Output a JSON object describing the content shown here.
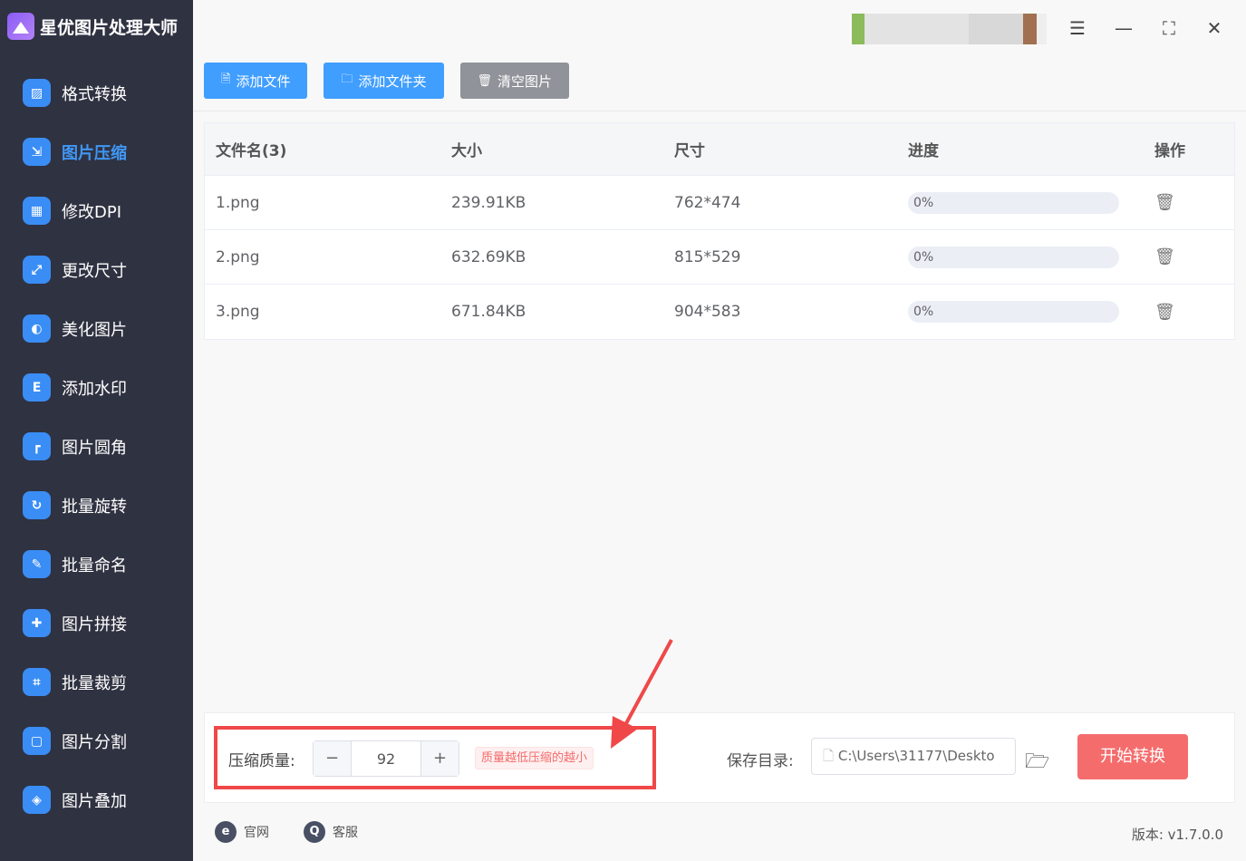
{
  "app": {
    "title": "星优图片处理大师",
    "accent": "#409eff"
  },
  "sidebar": {
    "items": [
      {
        "label": "格式转换",
        "icon": "image-convert-icon",
        "active": false
      },
      {
        "label": "图片压缩",
        "icon": "image-compress-icon",
        "active": true
      },
      {
        "label": "修改DPI",
        "icon": "dpi-icon",
        "active": false
      },
      {
        "label": "更改尺寸",
        "icon": "resize-icon",
        "active": false
      },
      {
        "label": "美化图片",
        "icon": "beautify-icon",
        "active": false
      },
      {
        "label": "添加水印",
        "icon": "watermark-icon",
        "active": false
      },
      {
        "label": "图片圆角",
        "icon": "round-corner-icon",
        "active": false
      },
      {
        "label": "批量旋转",
        "icon": "rotate-icon",
        "active": false
      },
      {
        "label": "批量命名",
        "icon": "rename-icon",
        "active": false
      },
      {
        "label": "图片拼接",
        "icon": "puzzle-icon",
        "active": false
      },
      {
        "label": "批量裁剪",
        "icon": "crop-icon",
        "active": false
      },
      {
        "label": "图片分割",
        "icon": "split-icon",
        "active": false
      },
      {
        "label": "图片叠加",
        "icon": "layers-icon",
        "active": false
      }
    ]
  },
  "toolbar": {
    "add_file": "添加文件",
    "add_folder": "添加文件夹",
    "clear": "清空图片"
  },
  "table": {
    "headers": [
      "文件名(3)",
      "大小",
      "尺寸",
      "进度",
      "操作"
    ],
    "rows": [
      {
        "name": "1.png",
        "size": "239.91KB",
        "dims": "762*474",
        "progress": "0%",
        "progress_value": 0
      },
      {
        "name": "2.png",
        "size": "632.69KB",
        "dims": "815*529",
        "progress": "0%",
        "progress_value": 0
      },
      {
        "name": "3.png",
        "size": "671.84KB",
        "dims": "904*583",
        "progress": "0%",
        "progress_value": 0
      }
    ]
  },
  "settings": {
    "quality_label": "压缩质量:",
    "quality_value": "92",
    "minus": "−",
    "plus": "+",
    "hint": "质量越低压缩的越小",
    "save_label": "保存目录:",
    "save_path": "C:\\Users\\31177\\Deskto",
    "start": "开始转换"
  },
  "footer": {
    "website": "官网",
    "support": "客服",
    "version": "版本: v1.7.0.0"
  }
}
